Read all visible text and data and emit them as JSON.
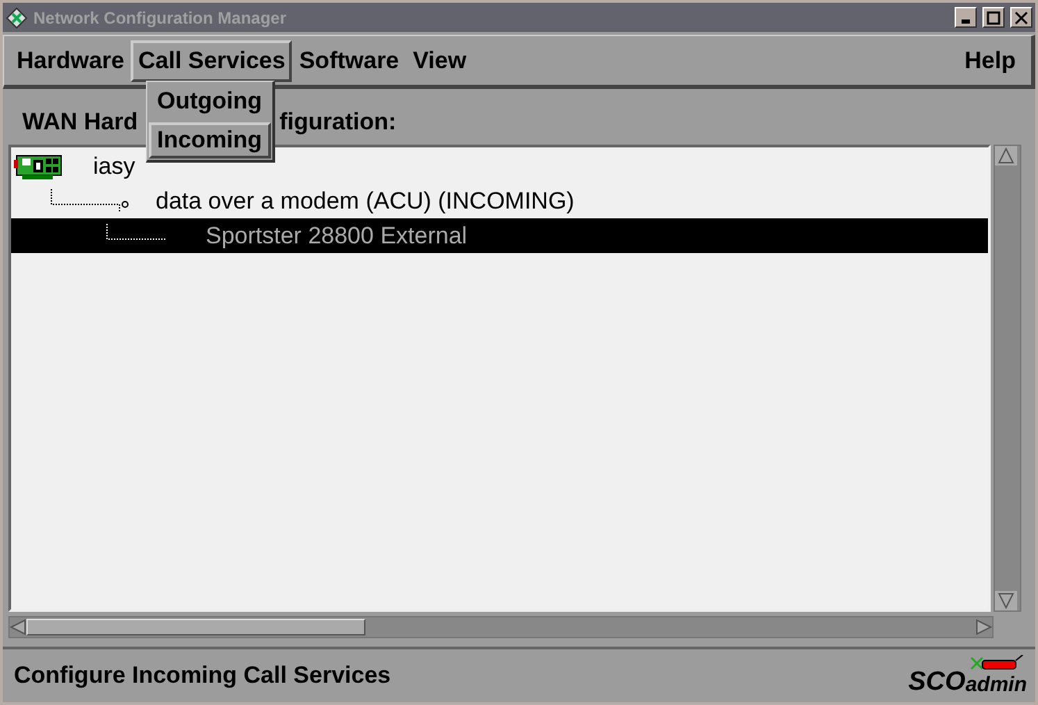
{
  "window": {
    "title": "Network Configuration Manager"
  },
  "menu_bar": {
    "left": [
      {
        "label": "Hardware",
        "selected": false
      },
      {
        "label": "Call Services",
        "selected": true,
        "dropdown": [
          {
            "label": "Outgoing",
            "selected": false
          },
          {
            "label": "Incoming",
            "selected": true
          }
        ]
      },
      {
        "label": "Software",
        "selected": false
      },
      {
        "label": "View",
        "selected": false
      }
    ],
    "right": [
      {
        "label": "Help",
        "selected": false
      }
    ]
  },
  "section_label": {
    "visible_parts": [
      "WAN Hard",
      "figuration:"
    ]
  },
  "tree": [
    {
      "label": "iasy",
      "selected": false,
      "children": [
        {
          "label": "data over a modem (ACU) (INCOMING)",
          "selected": false,
          "children": [
            {
              "label": "Sportster 28800 External",
              "selected": true
            }
          ]
        }
      ]
    }
  ],
  "status_bar": {
    "message": "Configure Incoming Call Services",
    "logo": [
      "SCO",
      "admin"
    ]
  }
}
